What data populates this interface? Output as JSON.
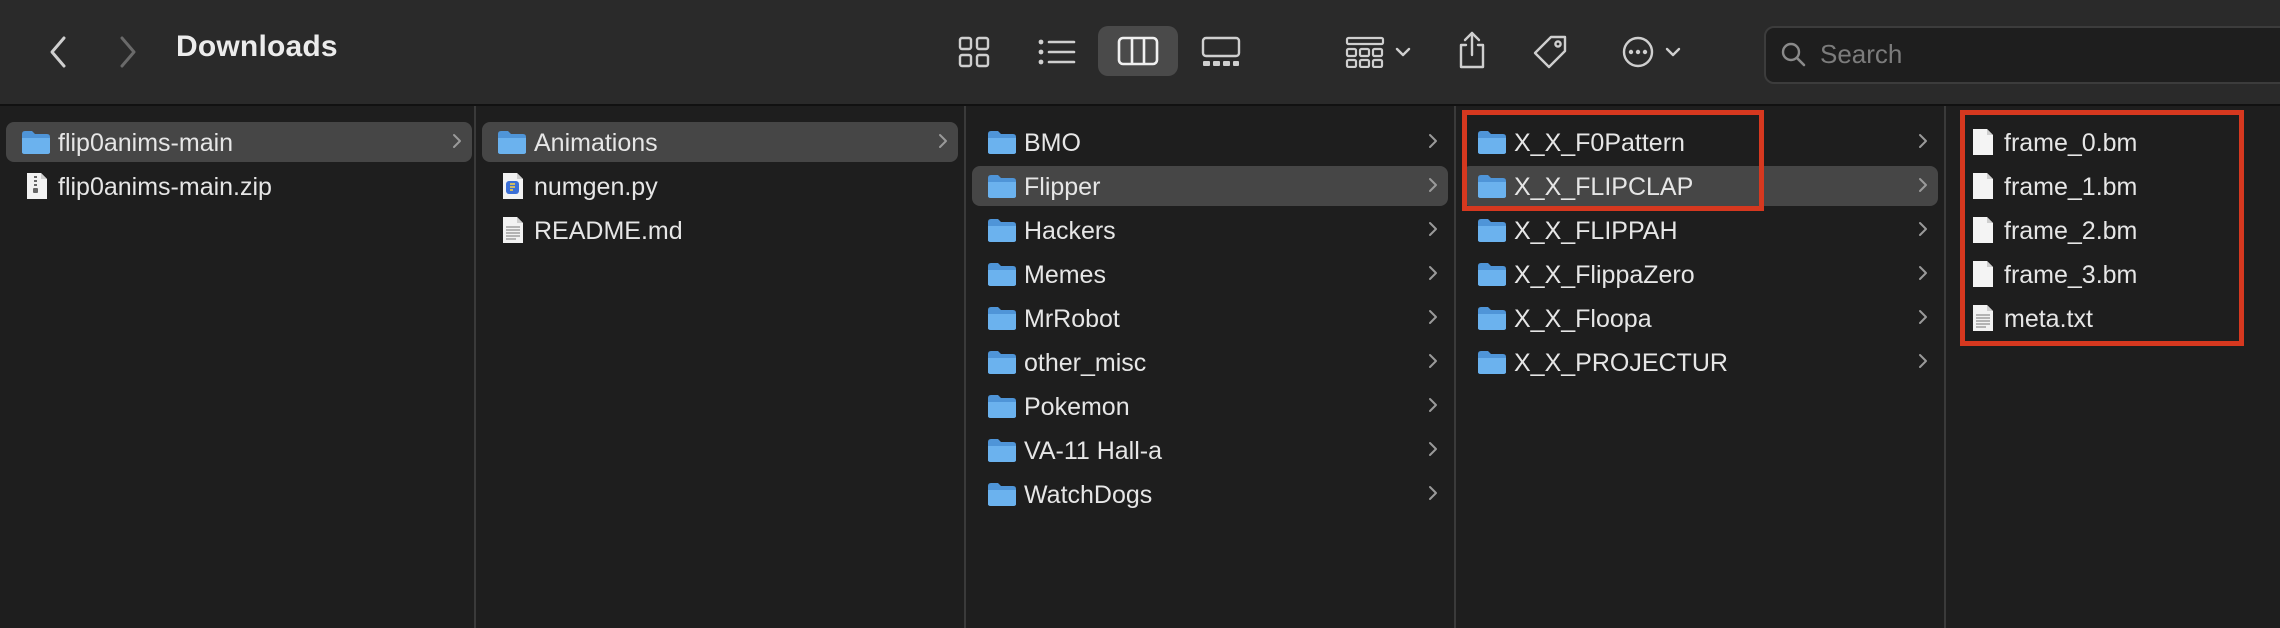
{
  "window": {
    "title": "Downloads"
  },
  "search": {
    "placeholder": "Search"
  },
  "columns": [
    {
      "items": [
        {
          "label": "flip0anims-main",
          "type": "folder",
          "selected": true,
          "has_children": true
        },
        {
          "label": "flip0anims-main.zip",
          "type": "zip",
          "selected": false,
          "has_children": false
        }
      ]
    },
    {
      "items": [
        {
          "label": "Animations",
          "type": "folder",
          "selected": true,
          "has_children": true
        },
        {
          "label": "numgen.py",
          "type": "python",
          "selected": false,
          "has_children": false
        },
        {
          "label": "README.md",
          "type": "doc",
          "selected": false,
          "has_children": false
        }
      ]
    },
    {
      "items": [
        {
          "label": "BMO",
          "type": "folder",
          "selected": false,
          "has_children": true
        },
        {
          "label": "Flipper",
          "type": "folder",
          "selected": true,
          "has_children": true
        },
        {
          "label": "Hackers",
          "type": "folder",
          "selected": false,
          "has_children": true
        },
        {
          "label": "Memes",
          "type": "folder",
          "selected": false,
          "has_children": true
        },
        {
          "label": "MrRobot",
          "type": "folder",
          "selected": false,
          "has_children": true
        },
        {
          "label": "other_misc",
          "type": "folder",
          "selected": false,
          "has_children": true
        },
        {
          "label": "Pokemon",
          "type": "folder",
          "selected": false,
          "has_children": true
        },
        {
          "label": "VA-11 Hall-a",
          "type": "folder",
          "selected": false,
          "has_children": true
        },
        {
          "label": "WatchDogs",
          "type": "folder",
          "selected": false,
          "has_children": true
        }
      ]
    },
    {
      "items": [
        {
          "label": "X_X_F0Pattern",
          "type": "folder",
          "selected": false,
          "has_children": true
        },
        {
          "label": "X_X_FLIPCLAP",
          "type": "folder",
          "selected": true,
          "has_children": true
        },
        {
          "label": "X_X_FLIPPAH",
          "type": "folder",
          "selected": false,
          "has_children": true
        },
        {
          "label": "X_X_FlippaZero",
          "type": "folder",
          "selected": false,
          "has_children": true
        },
        {
          "label": "X_X_Floopa",
          "type": "folder",
          "selected": false,
          "has_children": true
        },
        {
          "label": "X_X_PROJECTUR",
          "type": "folder",
          "selected": false,
          "has_children": true
        }
      ]
    },
    {
      "items": [
        {
          "label": "frame_0.bm",
          "type": "file",
          "selected": false,
          "has_children": false
        },
        {
          "label": "frame_1.bm",
          "type": "file",
          "selected": false,
          "has_children": false
        },
        {
          "label": "frame_2.bm",
          "type": "file",
          "selected": false,
          "has_children": false
        },
        {
          "label": "frame_3.bm",
          "type": "file",
          "selected": false,
          "has_children": false
        },
        {
          "label": "meta.txt",
          "type": "doc",
          "selected": false,
          "has_children": false
        }
      ]
    }
  ],
  "colors": {
    "highlight": "#d6381f",
    "folder": "#5aa4e6",
    "selection": "#464646"
  }
}
